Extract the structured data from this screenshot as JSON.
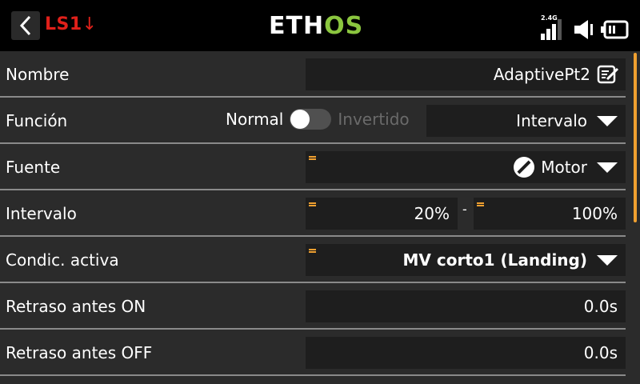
{
  "header": {
    "switch_label": "LS1",
    "switch_arrow": "↓",
    "logo_main": "ETH",
    "logo_accent": "OS",
    "rf_band": "2.4G",
    "icons": [
      "back-icon",
      "signal-bars-icon",
      "speaker-icon",
      "battery-icon"
    ]
  },
  "rows": {
    "name": {
      "label": "Nombre",
      "value": "AdaptivePt2"
    },
    "function": {
      "label": "Función",
      "toggle_left": "Normal",
      "toggle_right": "Invertido",
      "toggle_on": false,
      "value": "Intervalo"
    },
    "source": {
      "label": "Fuente",
      "value": "Motor"
    },
    "range": {
      "label": "Intervalo",
      "min": "20%",
      "separator": "-",
      "max": "100%"
    },
    "active_condition": {
      "label": "Condic. activa",
      "value": "MV corto1 (Landing)"
    },
    "delay_on": {
      "label": "Retraso antes ON",
      "value": "0.0s"
    },
    "delay_off": {
      "label": "Retraso antes OFF",
      "value": "0.0s"
    }
  },
  "colors": {
    "accent_orange": "#f0a030",
    "logo_green": "#8bc63f",
    "switch_red": "#e0201a"
  }
}
